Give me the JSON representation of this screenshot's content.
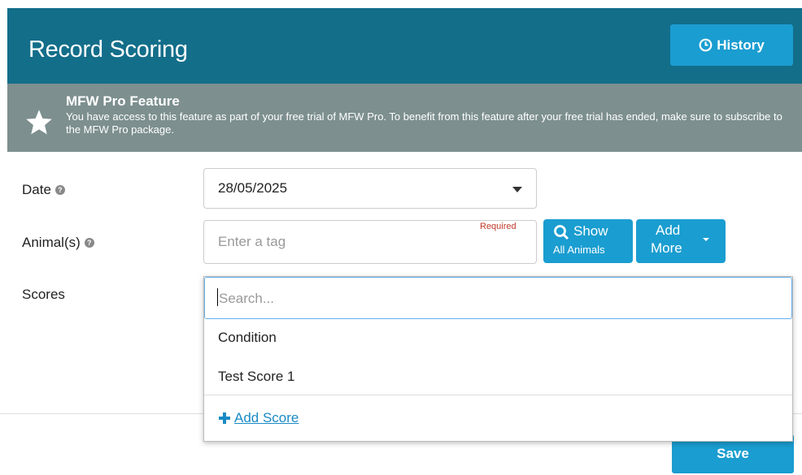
{
  "header": {
    "title": "Record Scoring",
    "history_label": "History"
  },
  "pro_banner": {
    "title": "MFW Pro Feature",
    "text": "You have access to this feature as part of your free trial of MFW Pro. To benefit from this feature after your free trial has ended, make sure to subscribe to the MFW Pro package."
  },
  "form": {
    "date_label": "Date",
    "date_value": "28/05/2025",
    "animals_label": "Animal(s)",
    "tag_placeholder": "Enter a tag",
    "required_text": "Required",
    "show_line1": "Show",
    "show_line2": "All Animals",
    "add_line1": "Add",
    "add_line2": "More",
    "scores_label": "Scores",
    "save_label": "Save"
  },
  "scores_dropdown": {
    "search_placeholder": "Search...",
    "options": [
      "Condition",
      "Test Score 1"
    ],
    "add_label": "Add Score"
  },
  "colors": {
    "header_bg": "#136e8a",
    "banner_bg": "#7d8f8f",
    "button_blue": "#1a9dd0",
    "link_blue": "#1a8ac4",
    "required_red": "#c0392b"
  },
  "icons": {
    "history": "clock-icon",
    "banner": "star-icon",
    "help": "question-icon",
    "show": "search-icon",
    "add_score": "plus-icon"
  }
}
